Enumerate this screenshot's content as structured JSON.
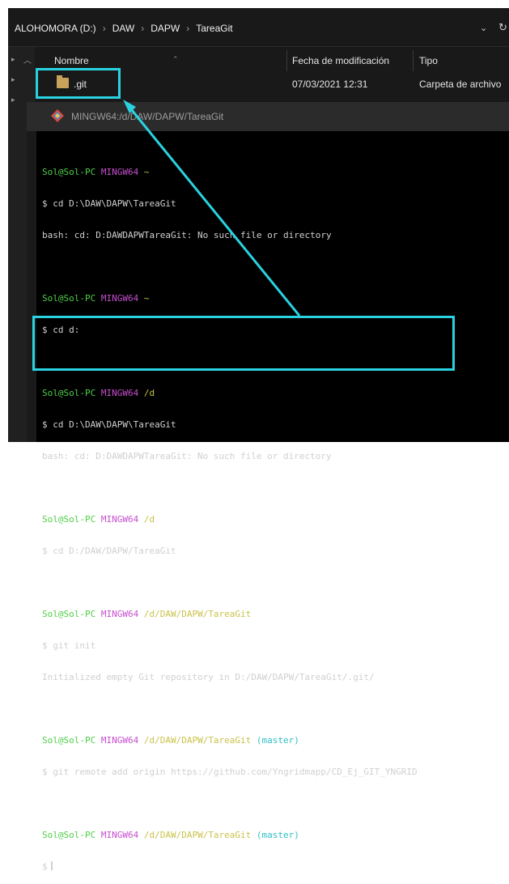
{
  "explorer": {
    "breadcrumb": [
      "ALOHOMORA (D:)",
      "DAW",
      "DAPW",
      "TareaGit"
    ],
    "columns": {
      "name": "Nombre",
      "modified": "Fecha de modificación",
      "type": "Tipo"
    },
    "rows": [
      {
        "name": ".git",
        "modified": "07/03/2021 12:31",
        "type": "Carpeta de archivo"
      }
    ]
  },
  "terminal": {
    "title": "MINGW64:/d/DAW/DAPW/TareaGit",
    "prompts": [
      {
        "user": "Sol@Sol-PC",
        "shell": "MINGW64",
        "path": "~"
      },
      {
        "user": "Sol@Sol-PC",
        "shell": "MINGW64",
        "path": "~"
      },
      {
        "user": "Sol@Sol-PC",
        "shell": "MINGW64",
        "path": "/d"
      },
      {
        "user": "Sol@Sol-PC",
        "shell": "MINGW64",
        "path": "/d"
      },
      {
        "user": "Sol@Sol-PC",
        "shell": "MINGW64",
        "path": "/d/DAW/DAPW/TareaGit"
      },
      {
        "user": "Sol@Sol-PC",
        "shell": "MINGW64",
        "path": "/d/DAW/DAPW/TareaGit",
        "branch": "(master)"
      },
      {
        "user": "Sol@Sol-PC",
        "shell": "MINGW64",
        "path": "/d/DAW/DAPW/TareaGit",
        "branch": "(master)"
      }
    ],
    "commands": [
      "$ cd D:\\DAW\\DAPW\\TareaGit",
      "$ cd d:",
      "$ cd D:\\DAW\\DAPW\\TareaGit",
      "$ cd D:/DAW/DAPW/TareaGit",
      "$ git init",
      "$ git remote add origin https://github.com/Yngridmapp/CD_Ej_GIT_YNGRID",
      "$"
    ],
    "outputs": [
      "bash: cd: D:DAWDAPWTareaGit: No such file or directory",
      "bash: cd: D:DAWDAPWTareaGit: No such file or directory",
      "Initialized empty Git repository in D:/DAW/DAPW/TareaGit/.git/"
    ]
  },
  "colors": {
    "highlight": "#2ad2e0",
    "user": "#4fcf48",
    "shell": "#c64ecf",
    "path": "#c9c24a",
    "branch": "#2fc0c5"
  }
}
